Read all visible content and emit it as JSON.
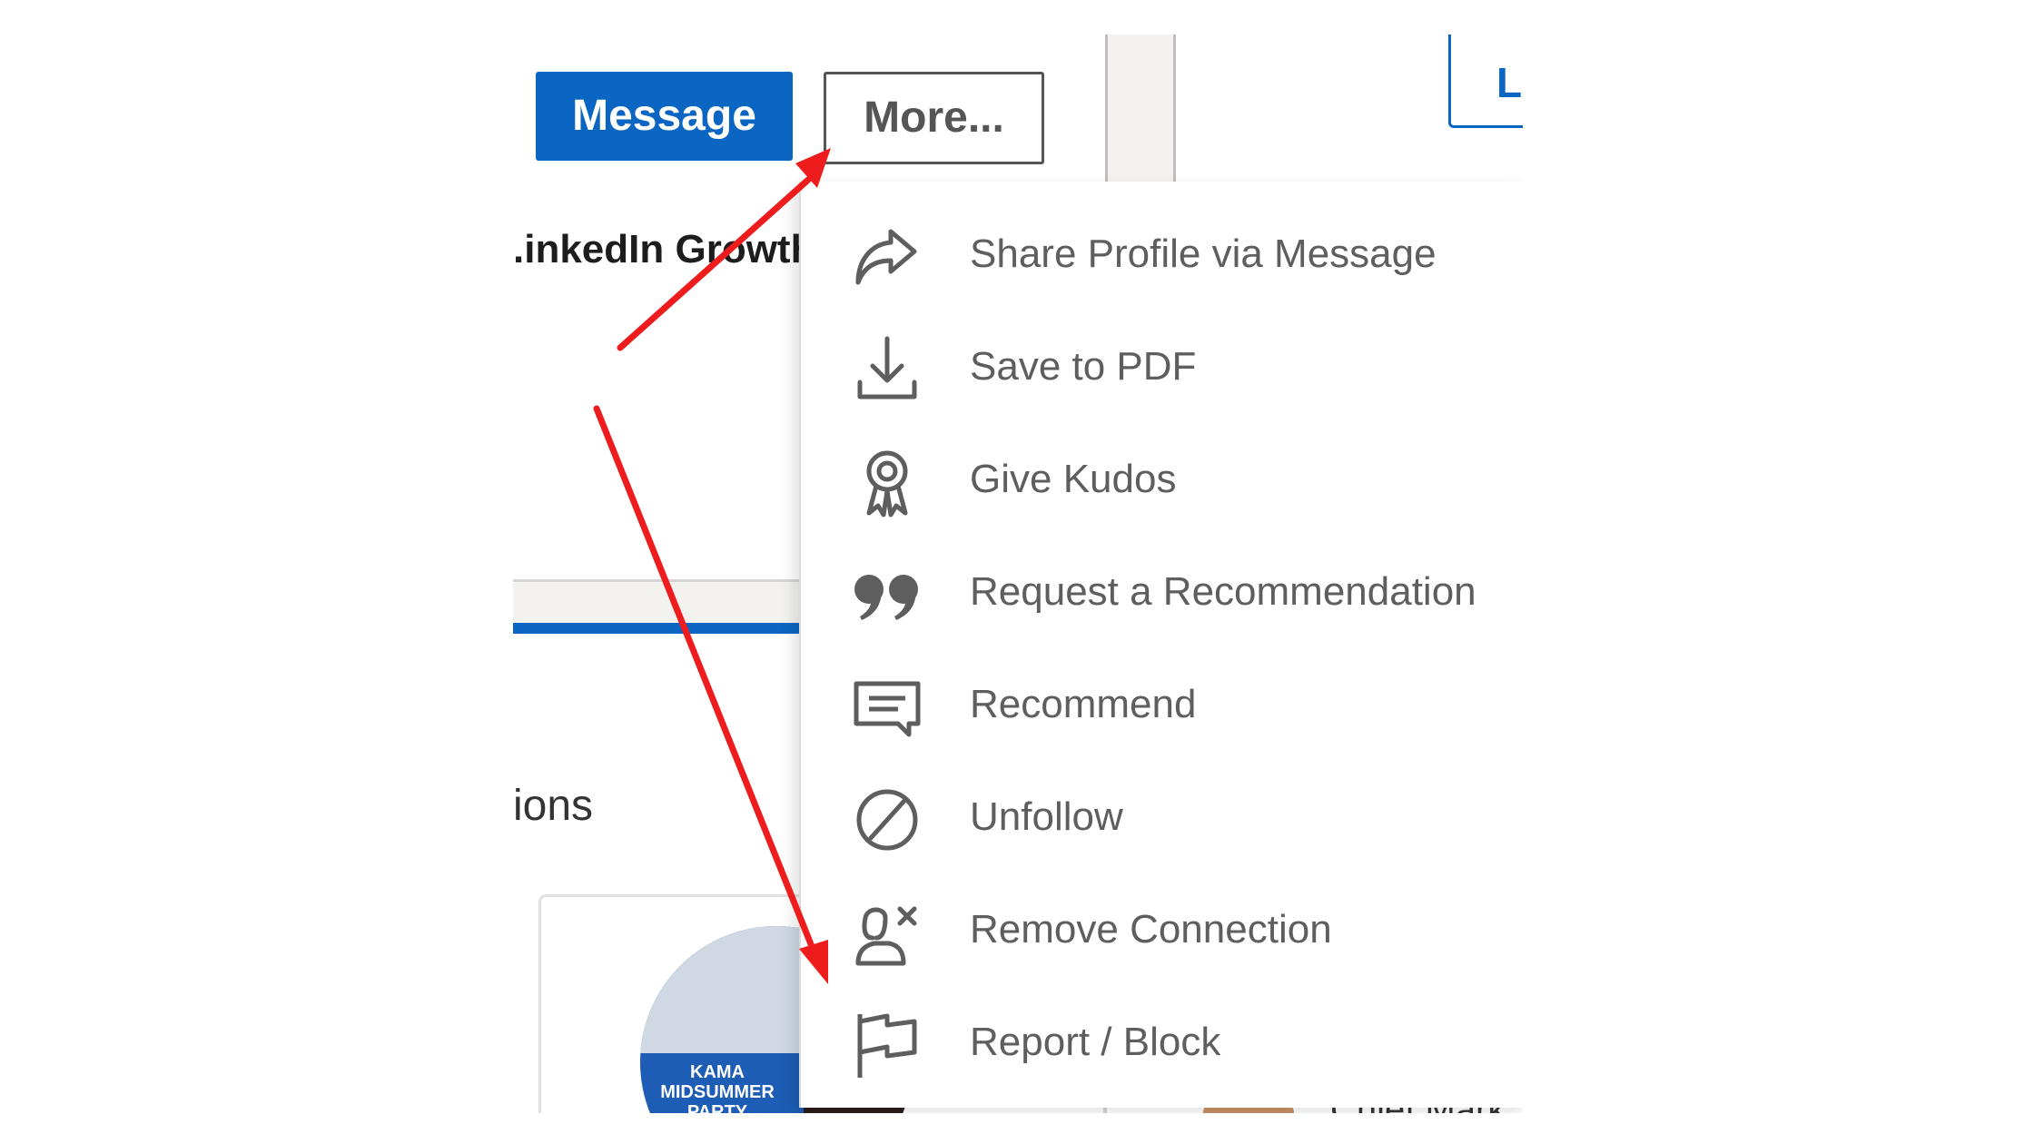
{
  "profile_actions": {
    "message_label": "Message",
    "more_label": "More...",
    "learn_label": "Le"
  },
  "background": {
    "headline_fragment": ".inkedIn Growth",
    "section_fragment": "ions",
    "event_image_text": "KAMA MIDSUMMER PARTY",
    "lower_fragment": "Chief Mark"
  },
  "dropdown": {
    "items": [
      {
        "label": "Share Profile via Message",
        "icon": "share-icon"
      },
      {
        "label": "Save to PDF",
        "icon": "download-icon"
      },
      {
        "label": "Give Kudos",
        "icon": "kudos-ribbon-icon"
      },
      {
        "label": "Request a Recommendation",
        "icon": "quote-icon"
      },
      {
        "label": "Recommend",
        "icon": "speech-bubble-icon"
      },
      {
        "label": "Unfollow",
        "icon": "unfollow-icon"
      },
      {
        "label": "Remove Connection",
        "icon": "remove-person-icon"
      },
      {
        "label": "Report / Block",
        "icon": "flag-icon"
      }
    ]
  },
  "annotation": {
    "arrow_color": "#ee1c1c"
  },
  "colors": {
    "brand_blue": "#0a66c2",
    "menu_text": "#5e5e5e"
  }
}
